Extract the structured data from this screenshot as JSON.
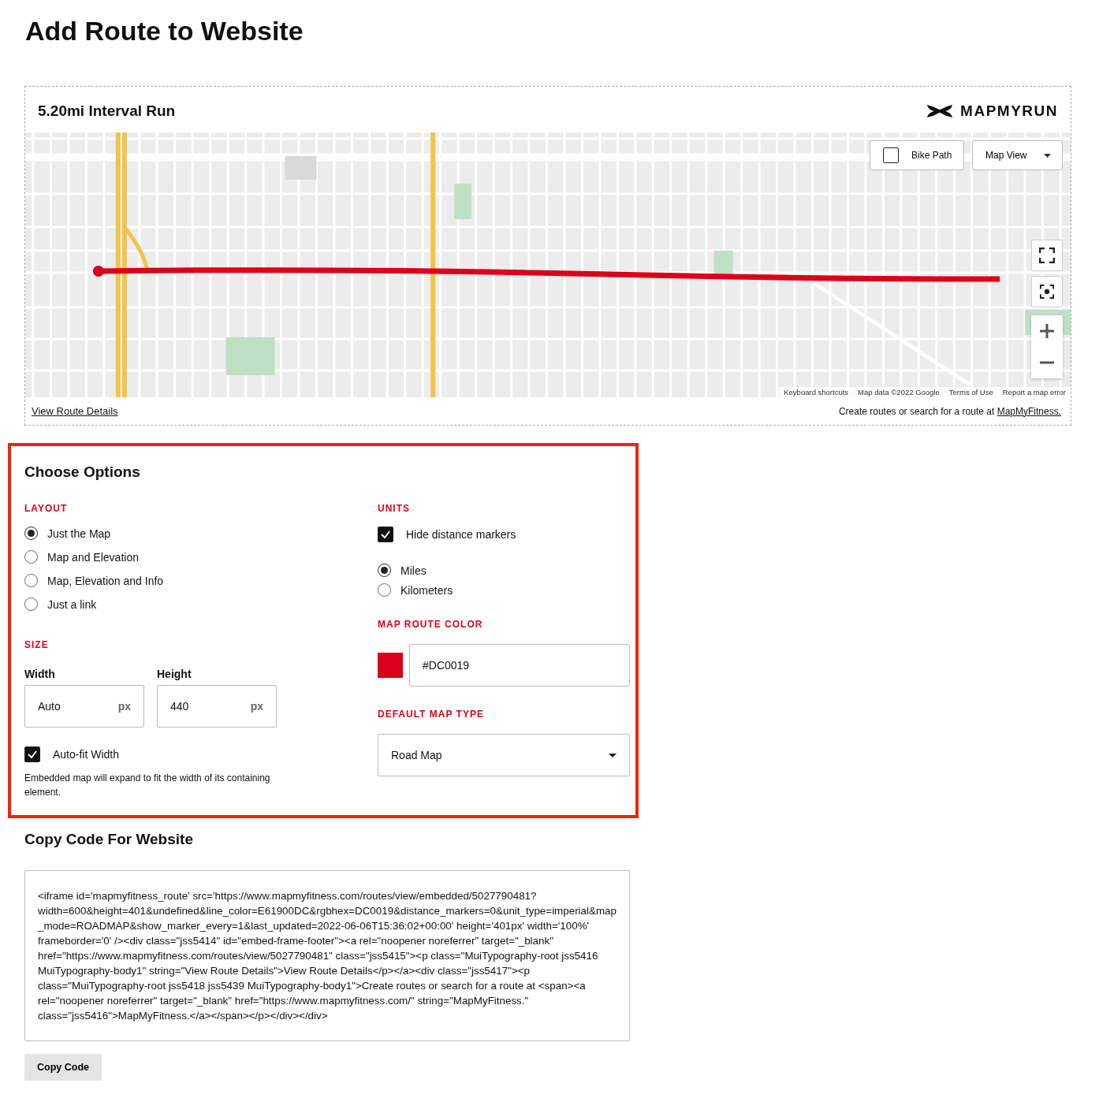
{
  "page_title": "Add Route to Website",
  "preview": {
    "route_name": "5.20mi Interval Run",
    "brand": "MAPMYRUN",
    "map": {
      "kind": "picture",
      "bike_path": {
        "label": "Bike Path",
        "checked": false
      },
      "map_type_button": "Map View",
      "attribution": [
        "Keyboard shortcuts",
        "Map data ©2022 Google",
        "Terms of Use",
        "Report a map error"
      ]
    },
    "details_link": "View Route Details",
    "footer_text": "Create routes or search for a route at ",
    "footer_link": "MapMyFitness."
  },
  "options": {
    "title": "Choose Options",
    "layout": {
      "label": "LAYOUT",
      "choices": [
        {
          "label": "Just the Map",
          "selected": true
        },
        {
          "label": "Map and Elevation",
          "selected": false
        },
        {
          "label": "Map, Elevation and Info",
          "selected": false
        },
        {
          "label": "Just a link",
          "selected": false
        }
      ]
    },
    "size": {
      "label": "SIZE",
      "width": {
        "label": "Width",
        "value": "Auto",
        "unit": "px"
      },
      "height": {
        "label": "Height",
        "value": "440",
        "unit": "px"
      },
      "autofit": {
        "label": "Auto-fit Width",
        "checked": true
      },
      "note": "Embedded map will expand to fit the width of its containing element."
    },
    "units": {
      "label": "UNITS",
      "hide_markers": {
        "label": "Hide distance markers",
        "checked": true
      },
      "choices": [
        {
          "label": "Miles",
          "selected": true
        },
        {
          "label": "Kilometers",
          "selected": false
        }
      ]
    },
    "route_color": {
      "label": "MAP ROUTE COLOR",
      "color": "#dc0019",
      "value": "#DC0019"
    },
    "map_type": {
      "label": "DEFAULT MAP TYPE",
      "value": "Road Map"
    }
  },
  "code": {
    "title": "Copy Code For Website",
    "text": "<iframe id='mapmyfitness_route' src='https://www.mapmyfitness.com/routes/view/embedded/5027790481?width=600&height=401&undefined&line_color=E61900DC&rgbhex=DC0019&distance_markers=0&unit_type=imperial&map_mode=ROADMAP&show_marker_every=1&last_updated=2022-06-06T15:36:02+00:00' height='401px' width='100%' frameborder='0' /><div class=\"jss5414\" id=\"embed-frame-footer\"><a rel=\"noopener noreferrer\" target=\"_blank\" href=\"https://www.mapmyfitness.com/routes/view/5027790481\" class=\"jss5415\"><p class=\"MuiTypography-root jss5416 MuiTypography-body1\" string=\"View Route Details\">View Route Details</p></a><div class=\"jss5417\"><p class=\"MuiTypography-root jss5418 jss5439 MuiTypography-body1\">Create routes or search for a route at <span><a rel=\"noopener noreferrer\" target=\"_blank\" href=\"https://www.mapmyfitness.com/\" string=\"MapMyFitness.\" class=\"jss5416\">MapMyFitness.</a></span></p></div></div>",
    "button": "Copy Code"
  }
}
